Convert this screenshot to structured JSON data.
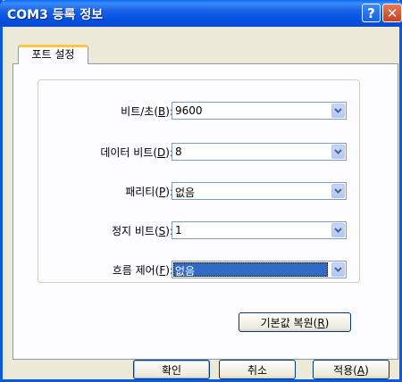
{
  "window": {
    "title": "COM3 등록 정보"
  },
  "titlebar": {
    "help_label": "?",
    "close_label": "✕"
  },
  "tabs": [
    {
      "label": "포트 설정"
    }
  ],
  "fields": [
    {
      "label_pre": "비트/초(",
      "mnemonic": "B",
      "label_post": "):",
      "value": "9600"
    },
    {
      "label_pre": "데이터 비트(",
      "mnemonic": "D",
      "label_post": "):",
      "value": "8"
    },
    {
      "label_pre": "패리티(",
      "mnemonic": "P",
      "label_post": "):",
      "value": "없음"
    },
    {
      "label_pre": "정지 비트(",
      "mnemonic": "S",
      "label_post": "):",
      "value": "1"
    },
    {
      "label_pre": "흐름 제어(",
      "mnemonic": "F",
      "label_post": "):",
      "value": "없음"
    }
  ],
  "restore_button": {
    "label_pre": "기본값 복원(",
    "mnemonic": "R",
    "label_post": ")"
  },
  "footer": {
    "ok_label": "확인",
    "cancel_label": "취소",
    "apply_pre": "적용(",
    "apply_mnemonic": "A",
    "apply_post": ")"
  },
  "colors": {
    "title_bar": "#0a5ae0",
    "selection": "#316ac5",
    "tab_highlight": "#ffc83c"
  }
}
